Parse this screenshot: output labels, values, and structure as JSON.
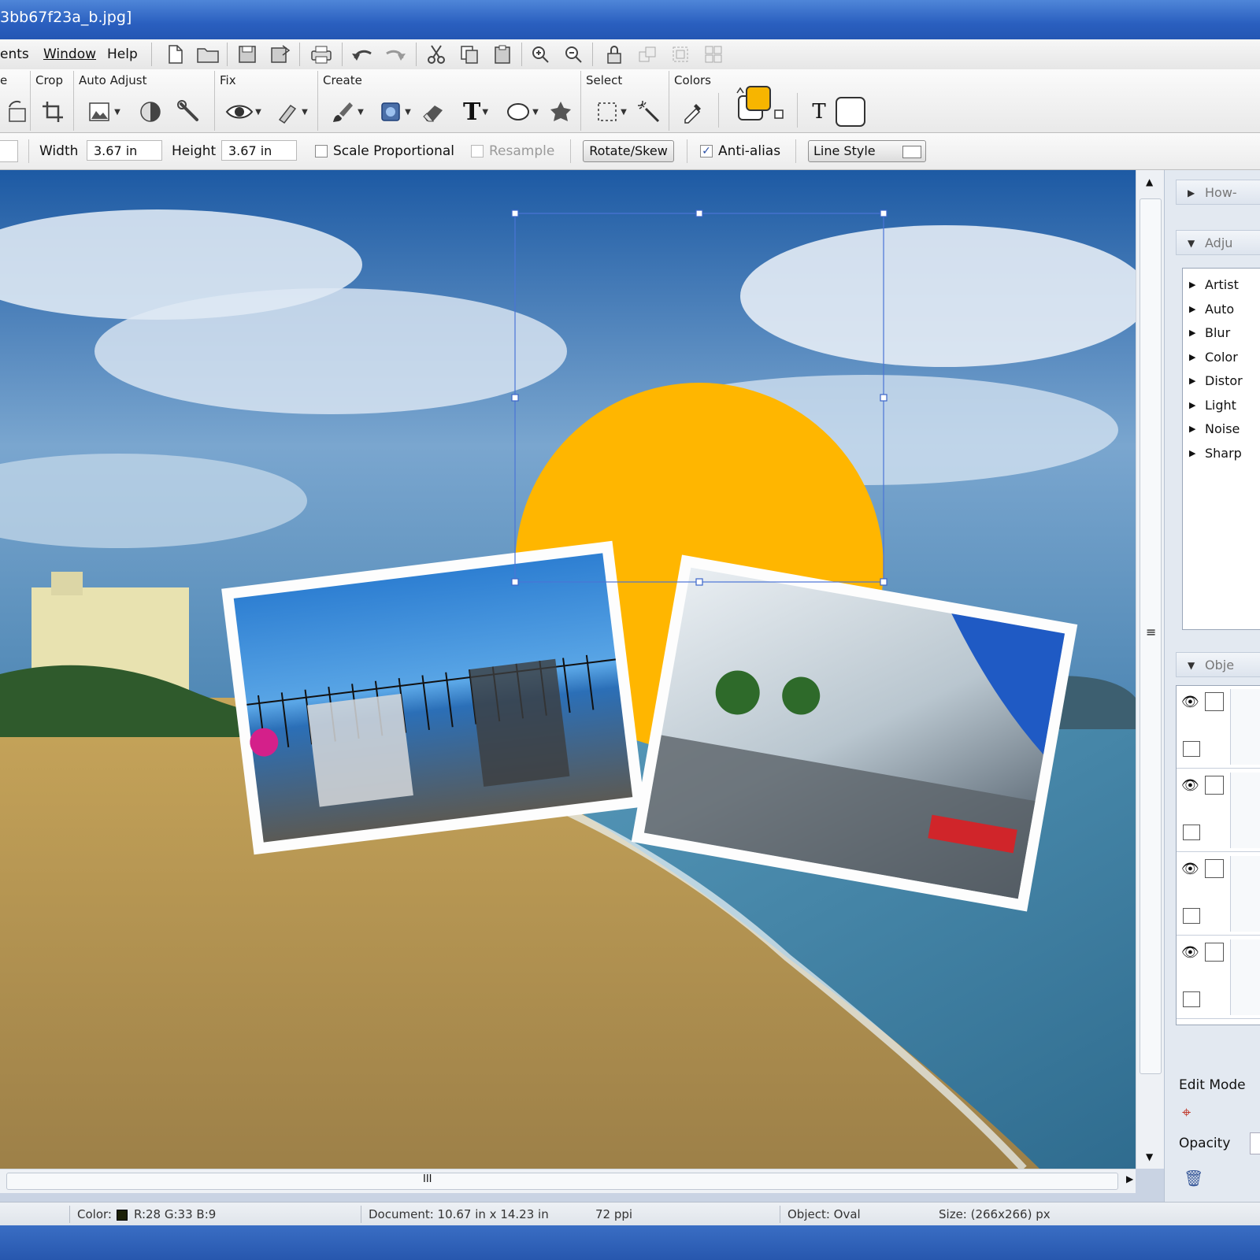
{
  "window": {
    "title": "3bb67f23a_b.jpg]"
  },
  "menu": {
    "items": [
      "ents",
      "Window",
      "Help"
    ]
  },
  "ribbon": {
    "groups": [
      "e",
      "Crop",
      "Auto Adjust",
      "Fix",
      "Create",
      "Select",
      "Colors"
    ],
    "text_tool": "T",
    "primary_color": "#F7B500",
    "secondary_color": "#FFFFFF"
  },
  "options": {
    "width_label": "Width",
    "width_value": "3.67 in",
    "height_label": "Height",
    "height_value": "3.67 in",
    "scale_label": "Scale Proportional",
    "scale_checked": false,
    "resample_label": "Resample",
    "resample_checked": false,
    "rotate_label": "Rotate/Skew",
    "antialias_label": "Anti-alias",
    "antialias_checked": true,
    "antialias_mark": "✓",
    "linestyle_label": "Line Style"
  },
  "canvas": {
    "sun_color": "#FFB600"
  },
  "panel": {
    "howto_label": "How-",
    "adjust_label": "Adju",
    "adjust_items": [
      "Artist",
      "Auto",
      "Blur",
      "Color",
      "Distor",
      "Light",
      "Noise",
      "Sharp"
    ],
    "objects_label": "Obje",
    "edit_mode_label": "Edit Mode",
    "opacity_label": "Opacity"
  },
  "status": {
    "color_label": "Color:",
    "color_swatch": "#1C2109",
    "rgb": "R:28  G:33  B:9",
    "document": "Document: 10.67 in x 14.23 in",
    "ppi": "72 ppi",
    "object": "Object: Oval",
    "size": "Size: (266x266) px"
  },
  "scroll": {
    "h_grip": "III",
    "v_grip": "≡"
  }
}
